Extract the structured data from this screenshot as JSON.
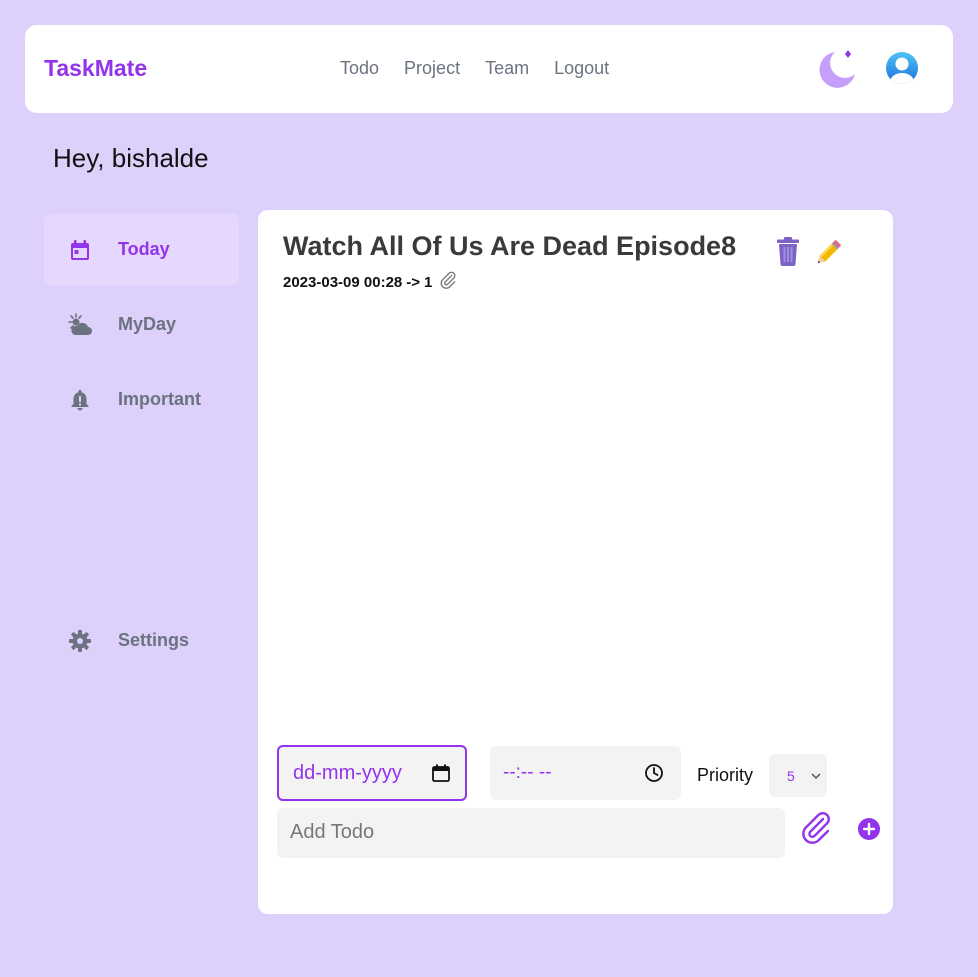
{
  "header": {
    "brand": "TaskMate",
    "nav": [
      "Todo",
      "Project",
      "Team",
      "Logout"
    ]
  },
  "greeting": "Hey, bishalde",
  "sidebar": {
    "items": [
      {
        "label": "Today",
        "icon": "calendar-icon",
        "active": true
      },
      {
        "label": "MyDay",
        "icon": "sun-cloud-icon",
        "active": false
      },
      {
        "label": "Important",
        "icon": "bell-icon",
        "active": false
      }
    ],
    "settings": {
      "label": "Settings",
      "icon": "gear-icon"
    }
  },
  "todo": {
    "title": "Watch All Of Us Are Dead Episode8",
    "datetime": "2023-03-09 00:28",
    "arrow": "->",
    "priority": "1"
  },
  "form": {
    "date_placeholder": "dd-mm-yyyy",
    "time_placeholder": "--:-- --",
    "priority_label": "Priority",
    "priority_value": "5",
    "add_placeholder": "Add Todo"
  },
  "colors": {
    "accent": "#9333ea",
    "background": "#ddd1fb",
    "active_item": "#e5d8fc",
    "muted_text": "#6b7280"
  }
}
